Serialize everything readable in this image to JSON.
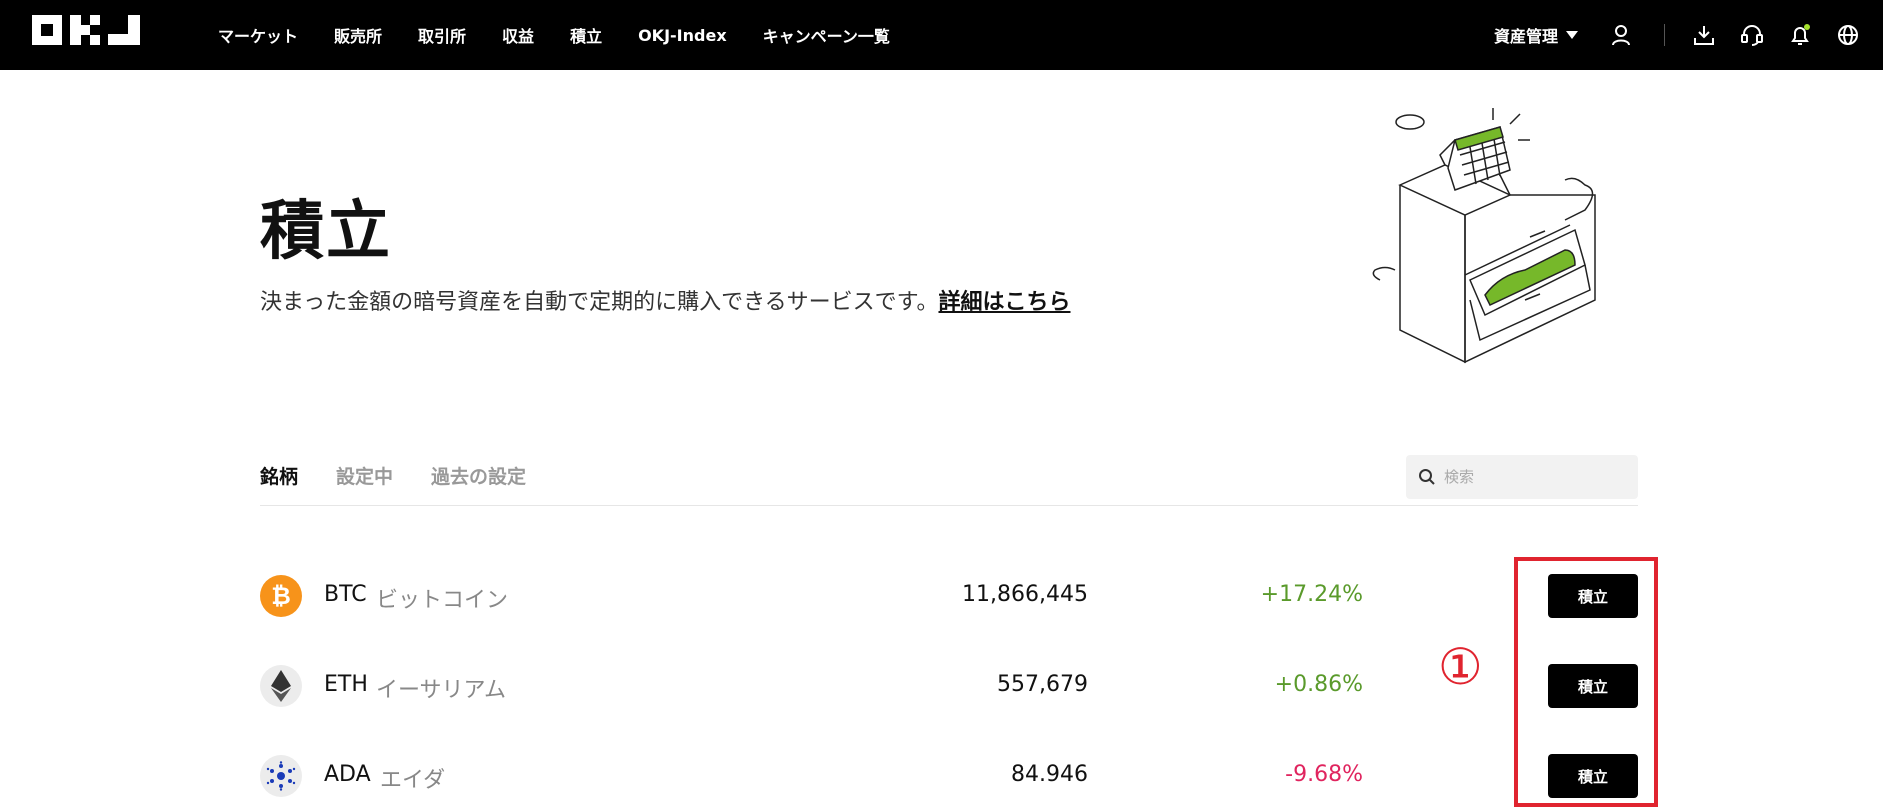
{
  "nav": {
    "items": [
      "マーケット",
      "販売所",
      "取引所",
      "収益",
      "積立",
      "OKJ-Index",
      "キャンペーン一覧"
    ],
    "asset_menu": "資産管理",
    "icons": [
      "user-icon",
      "download-icon",
      "support-headset-icon",
      "bell-icon",
      "globe-icon"
    ]
  },
  "hero": {
    "title": "積立",
    "description": "決まった金額の暗号資産を自動で定期的に購入できるサービスです。",
    "link": "詳細はこちら"
  },
  "tabs": [
    "銘柄",
    "設定中",
    "過去の設定"
  ],
  "search": {
    "placeholder": "検索"
  },
  "coins": [
    {
      "symbol": "BTC",
      "name": "ビットコイン",
      "price": "11,866,445",
      "change": "+17.24%",
      "button": "積立",
      "color": "#f7931a"
    },
    {
      "symbol": "ETH",
      "name": "イーサリアム",
      "price": "557,679",
      "change": "+0.86%",
      "button": "積立",
      "color": "#ececec"
    },
    {
      "symbol": "ADA",
      "name": "エイダ",
      "price": "84.946",
      "change": "-9.68%",
      "button": "積立",
      "color": "#ececec"
    }
  ],
  "annotation": {
    "number": "①",
    "color": "#e0242f"
  },
  "colors": {
    "up": "#5a9a2b",
    "down": "#e0245e",
    "accent_green": "#76b82a"
  }
}
